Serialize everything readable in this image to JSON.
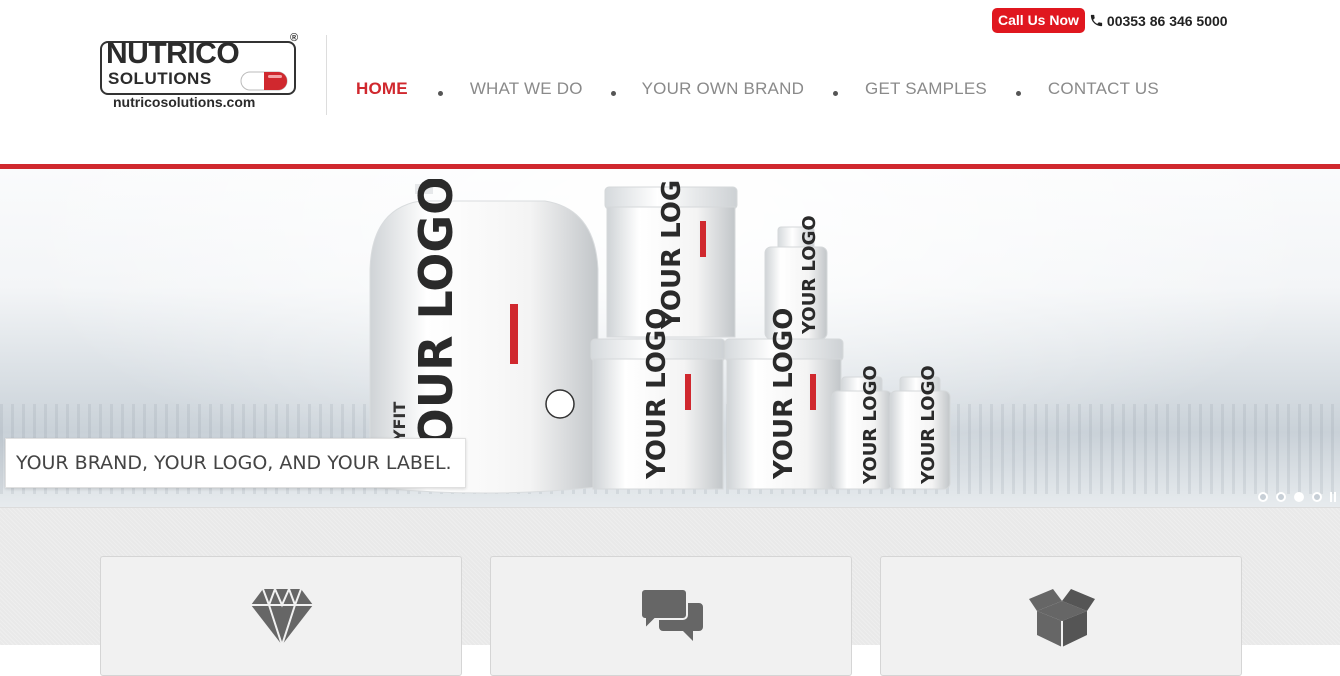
{
  "header": {
    "call_label": "Call Us Now",
    "phone": "00353 86 346 5000",
    "phone_icon": "phone-icon",
    "logo": {
      "name": "NUTRICO",
      "sub": "SOLUTIONS",
      "reg": "®",
      "url": "nutricosolutions.com"
    },
    "nav": [
      {
        "label": "HOME",
        "active": true
      },
      {
        "label": "WHAT WE DO",
        "active": false
      },
      {
        "label": "YOUR OWN BRAND",
        "active": false
      },
      {
        "label": "GET SAMPLES",
        "active": false
      },
      {
        "label": "CONTACT US",
        "active": false
      }
    ]
  },
  "hero": {
    "caption": "YOUR BRAND, YOUR LOGO, AND YOUR LABEL.",
    "product_text": "YOUR LOGO",
    "product_brand": "BODYFIT",
    "slides": 4,
    "active_slide": 3
  },
  "features": [
    {
      "icon": "diamond-icon"
    },
    {
      "icon": "speech-bubbles-icon"
    },
    {
      "icon": "open-box-icon"
    }
  ],
  "colors": {
    "accent": "#d0282e",
    "call_button": "#e0171f",
    "nav_text": "#8a8a8a"
  }
}
